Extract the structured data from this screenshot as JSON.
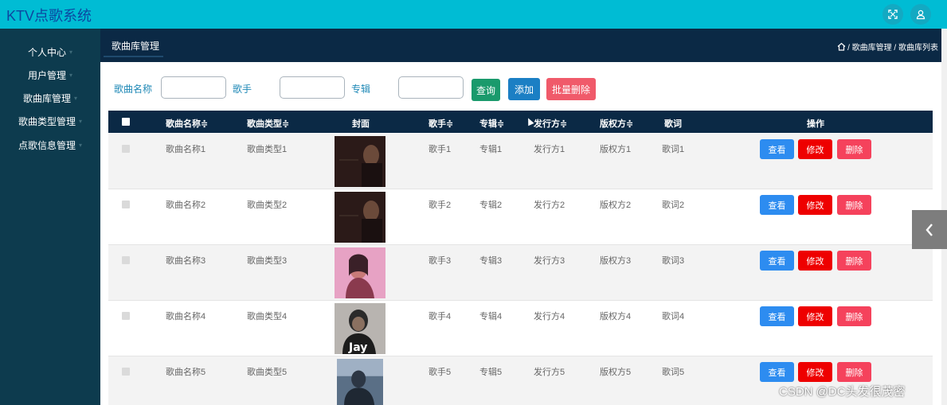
{
  "app": {
    "title": "KTV点歌系统"
  },
  "topbar": {
    "icons": [
      "fullscreen-icon",
      "user-icon"
    ]
  },
  "sidebar": {
    "items": [
      {
        "label": "个人中心"
      },
      {
        "label": "用户管理"
      },
      {
        "label": "歌曲库管理"
      },
      {
        "label": "歌曲类型管理"
      },
      {
        "label": "点歌信息管理"
      }
    ]
  },
  "header": {
    "page_title": "歌曲库管理",
    "breadcrumb": "/ 歌曲库管理 / 歌曲库列表"
  },
  "search": {
    "song_name_label": "歌曲名称",
    "singer_label": "歌手",
    "album_label": "专辑",
    "song_name_value": "",
    "singer_value": "",
    "album_value": "",
    "query_label": "查询",
    "add_label": "添加",
    "batch_delete_label": "批量删除"
  },
  "table": {
    "headers": {
      "song_name": "歌曲名称≑",
      "song_type": "歌曲类型≑",
      "cover": "封面",
      "singer": "歌手≑",
      "album": "专辑≑",
      "publisher": "发行方≑",
      "copyright": "版权方≑",
      "lyrics": "歌词",
      "actions": "操作"
    },
    "rows": [
      {
        "song_name": "歌曲名称1",
        "song_type": "歌曲类型1",
        "singer": "歌手1",
        "album": "专辑1",
        "publisher": "发行方1",
        "copyright": "版权方1",
        "lyrics": "歌词1",
        "cover_text": ""
      },
      {
        "song_name": "歌曲名称2",
        "song_type": "歌曲类型2",
        "singer": "歌手2",
        "album": "专辑2",
        "publisher": "发行方2",
        "copyright": "版权方2",
        "lyrics": "歌词2",
        "cover_text": ""
      },
      {
        "song_name": "歌曲名称3",
        "song_type": "歌曲类型3",
        "singer": "歌手3",
        "album": "专辑3",
        "publisher": "发行方3",
        "copyright": "版权方3",
        "lyrics": "歌词3",
        "cover_text": ""
      },
      {
        "song_name": "歌曲名称4",
        "song_type": "歌曲类型4",
        "singer": "歌手4",
        "album": "专辑4",
        "publisher": "发行方4",
        "copyright": "版权方4",
        "lyrics": "歌词4",
        "cover_text": "Jay"
      },
      {
        "song_name": "歌曲名称5",
        "song_type": "歌曲类型5",
        "singer": "歌手5",
        "album": "专辑5",
        "publisher": "发行方5",
        "copyright": "版权方5",
        "lyrics": "歌词5",
        "cover_text": ""
      }
    ],
    "actions": {
      "view": "查看",
      "edit": "修改",
      "delete": "删除"
    }
  },
  "watermark": "CSDN @DC头发很茂密",
  "colors": {
    "topbar": "#00bcd4",
    "sidebar": "#0d3b4e",
    "header": "#0b2945",
    "query_button": "#1a9a6c",
    "add_button": "#1b7fc4",
    "batch_delete_button": "#f05a6a",
    "view_button": "#2d8cf0",
    "edit_button": "#ee0000",
    "delete_button": "#f5425c"
  }
}
